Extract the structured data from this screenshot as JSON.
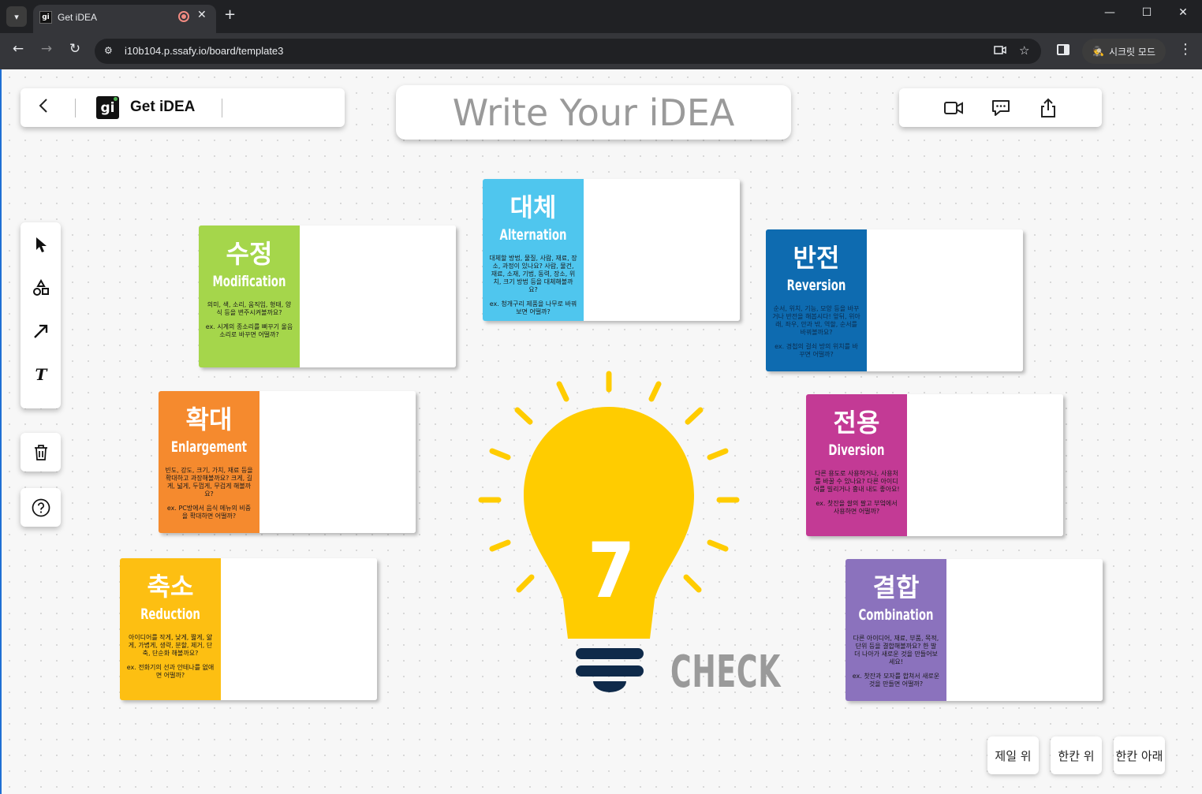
{
  "browser": {
    "tab_title": "Get iDEA",
    "tab_favicon": "gi",
    "url": "i10b104.p.ssafy.io/board/template3",
    "incognito_label": "시크릿 모드"
  },
  "header": {
    "brand": "Get iDEA",
    "logo_text": "gi",
    "title_placeholder": "Write Your iDEA"
  },
  "cards": [
    {
      "kr": "대체",
      "en": "Alternation",
      "color": "#4fc6ee",
      "desc": "대체할 방법, 물질, 사람, 재료, 장소, 과정이 있나요? 사람, 물건, 재료, 소재, 기법, 동력, 장소, 위치, 크기 방법 등을 대체해볼까요?",
      "ex": "ex. 청개구리 제품을 나무로 바꿔보면 어떨까?"
    },
    {
      "kr": "수정",
      "en": "Modification",
      "color": "#a5d64b",
      "desc": "의미, 색, 소리, 움직임, 형태, 양식 등을 변주시켜볼까요?",
      "ex": "ex. 시계의 종소리를 뻐꾸기 울음소리로 바꾸면 어떨까?"
    },
    {
      "kr": "반전",
      "en": "Reversion",
      "color": "#0e6bb0",
      "desc": "순서, 위치, 기능, 모양 등을 바꾸거나 반전을 해봅시다! 앞뒤, 위아래, 좌우, 안과 밖, 역할, 순서를 바꿔볼까요?",
      "ex": "ex. 경첩의 걸쇠 방의 위치를 바꾸면 어떨까?"
    },
    {
      "kr": "확대",
      "en": "Enlargement",
      "color": "#f58a2e",
      "desc": "빈도, 강도, 크기, 가치, 재료 등을 확대하고 과장해볼까요? 크게, 길게, 넓게, 두껍게, 무겁게 해볼까요?",
      "ex": "ex. PC방에서 음식 메뉴의 비중을 확대하면 어떨까?"
    },
    {
      "kr": "전용",
      "en": "Diversion",
      "color": "#c33a95",
      "desc": "다른 용도로 사용하거나, 사용처를 바꿀 수 있나요? 다른 아이디어를 빌리거나 흉내 내도 좋아요!",
      "ex": "ex. 찻잔을 쌀의 팔고 부엌에서 사용하면 어떨까?"
    },
    {
      "kr": "축소",
      "en": "Reduction",
      "color": "#fdbf12",
      "desc": "아이디어를 작게, 낮게, 짧게, 얇게, 가볍게, 생략, 분할, 제거, 단축, 단순화 해볼까요?",
      "ex": "ex. 전화기의 선과 안테나를 없애면 어떨까?"
    },
    {
      "kr": "결합",
      "en": "Combination",
      "color": "#8b72bd",
      "desc": "다른 아이디어, 재료, 부품, 목적, 단위 등을 결합해볼까요? 한 발 더 나아가 새로운 것을 만들어보세요!",
      "ex": "ex. 찻잔과 모자를 합쳐서 새로운 것을 만들면 어떨까?"
    }
  ],
  "bulb": {
    "number": "7",
    "check_label": "CHECK",
    "bulb_color": "#ffcc00",
    "base_color": "#0f2a4a",
    "check_color": "#9a9a9a"
  },
  "order_buttons": [
    "제일 위",
    "한칸 위",
    "한칸 아래"
  ]
}
